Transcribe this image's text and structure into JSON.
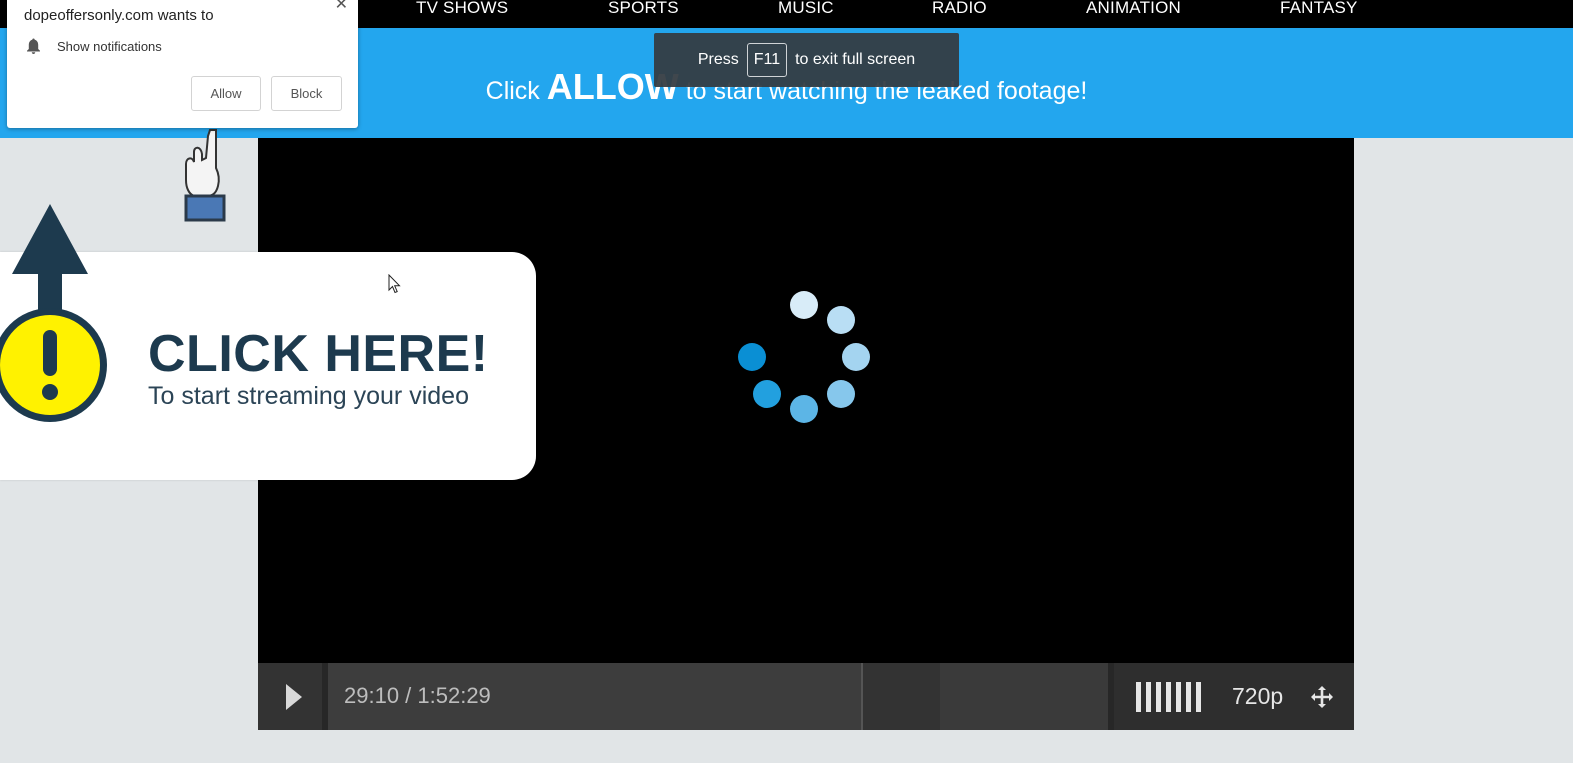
{
  "nav": {
    "items": [
      {
        "label": "TV SHOWS"
      },
      {
        "label": "SPORTS"
      },
      {
        "label": "MUSIC"
      },
      {
        "label": "RADIO"
      },
      {
        "label": "ANIMATION"
      },
      {
        "label": "FANTASY"
      }
    ]
  },
  "banner": {
    "lead": "Click",
    "emphasis": "ALLOW",
    "rest": "to start watching the leaked footage!"
  },
  "fullscreen_toast": {
    "press": "Press",
    "key": "F11",
    "rest": "to exit full screen"
  },
  "notification": {
    "site": "dopeoffersonly.com wants to",
    "permission": "Show notifications",
    "allow_label": "Allow",
    "block_label": "Block",
    "close_icon": "close-icon",
    "bell_icon": "bell-icon"
  },
  "promo": {
    "title": "CLICK HERE!",
    "subtitle": "To start streaming your video",
    "colors": {
      "title": "#1d3a4e",
      "badge": "#fff200",
      "arrow": "#1d3a4e"
    }
  },
  "player": {
    "time": "29:10 / 1:52:29",
    "quality": "720p",
    "progress_fraction": 0.259,
    "icons": {
      "play": "play-icon",
      "volume": "volume-bars-icon",
      "fullscreen": "fullscreen-icon",
      "spinner": "loading-spinner-icon"
    }
  },
  "colors": {
    "banner": "#23a6ee",
    "page_bg": "#e1e5e7",
    "nav_bg": "#000000",
    "player_bg": "#000000"
  }
}
